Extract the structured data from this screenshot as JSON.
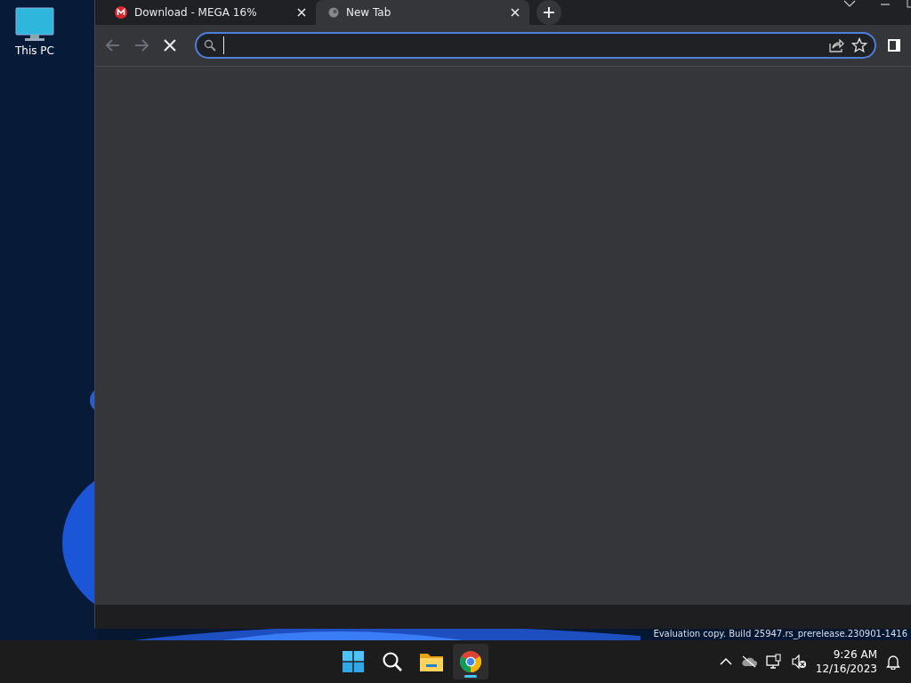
{
  "desktop": {
    "icons": [
      {
        "label": "This PC"
      }
    ],
    "build_text": "Evaluation copy. Build 25947.rs_prerelease.230901-1416"
  },
  "browser": {
    "tabs": [
      {
        "title": "Download - MEGA 16%",
        "selected": false,
        "kind": "mega"
      },
      {
        "title": "New Tab",
        "selected": true,
        "kind": "loading"
      }
    ],
    "address_bar": {
      "focused": true
    }
  },
  "taskbar": {
    "apps": [
      {
        "kind": "start",
        "running": false
      },
      {
        "kind": "search",
        "running": false
      },
      {
        "kind": "files",
        "running": false
      },
      {
        "kind": "chrome",
        "running": true
      }
    ],
    "time": "9:26 AM",
    "date": "12/16/2023"
  }
}
